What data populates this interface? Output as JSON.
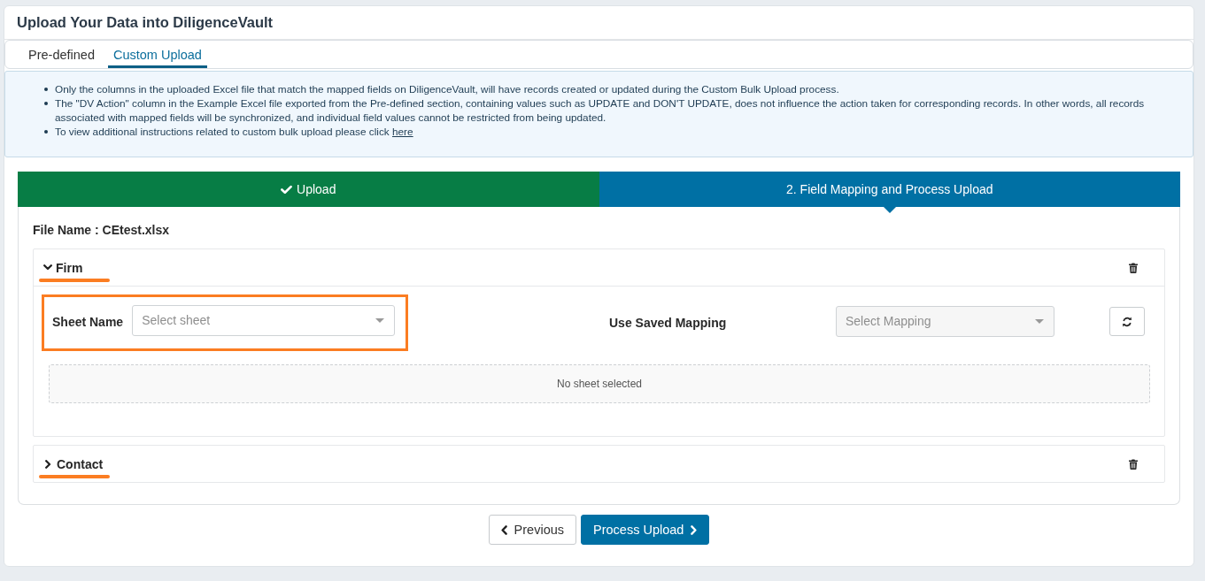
{
  "page": {
    "title": "Upload Your Data into DiligenceVault"
  },
  "tabs": [
    {
      "label": "Pre-defined",
      "selected": false
    },
    {
      "label": "Custom Upload",
      "selected": true
    }
  ],
  "instructions": [
    {
      "text": "Only the columns in the uploaded Excel file that match the mapped fields on DiligenceVault, will have records created or updated during the Custom Bulk Upload process."
    },
    {
      "text": "The \"DV Action\" column in the Example Excel file exported from the Pre-defined section, containing values such as UPDATE and DON'T UPDATE, does not influence the action taken for corresponding records. In other words, all records associated with mapped fields will be synchronized, and individual field values cannot be restricted from being updated."
    },
    {
      "text": "To view additional instructions related to custom bulk upload please click",
      "link": "here"
    }
  ],
  "steps": [
    {
      "label": "Upload",
      "completed": true,
      "selected": false
    },
    {
      "label": "2. Field Mapping and Process Upload",
      "completed": false,
      "selected": true
    }
  ],
  "file_name": "File Name : CEtest.xlsx",
  "sections": [
    {
      "title": "Firm",
      "expanded": true,
      "highlighted": true,
      "sheet": {
        "label": "Sheet Name",
        "placeholder": "Select sheet",
        "disabled": false,
        "highlighted": true
      },
      "mapping": {
        "label": "Use Saved Mapping",
        "placeholder": "Select Mapping",
        "disabled": true
      },
      "empty_message": "No sheet selected"
    },
    {
      "title": "Contact",
      "expanded": false,
      "highlighted": true
    }
  ],
  "buttons": [
    {
      "label": "Previous",
      "kind": "back"
    },
    {
      "label": "Process Upload",
      "kind": "primary"
    }
  ]
}
